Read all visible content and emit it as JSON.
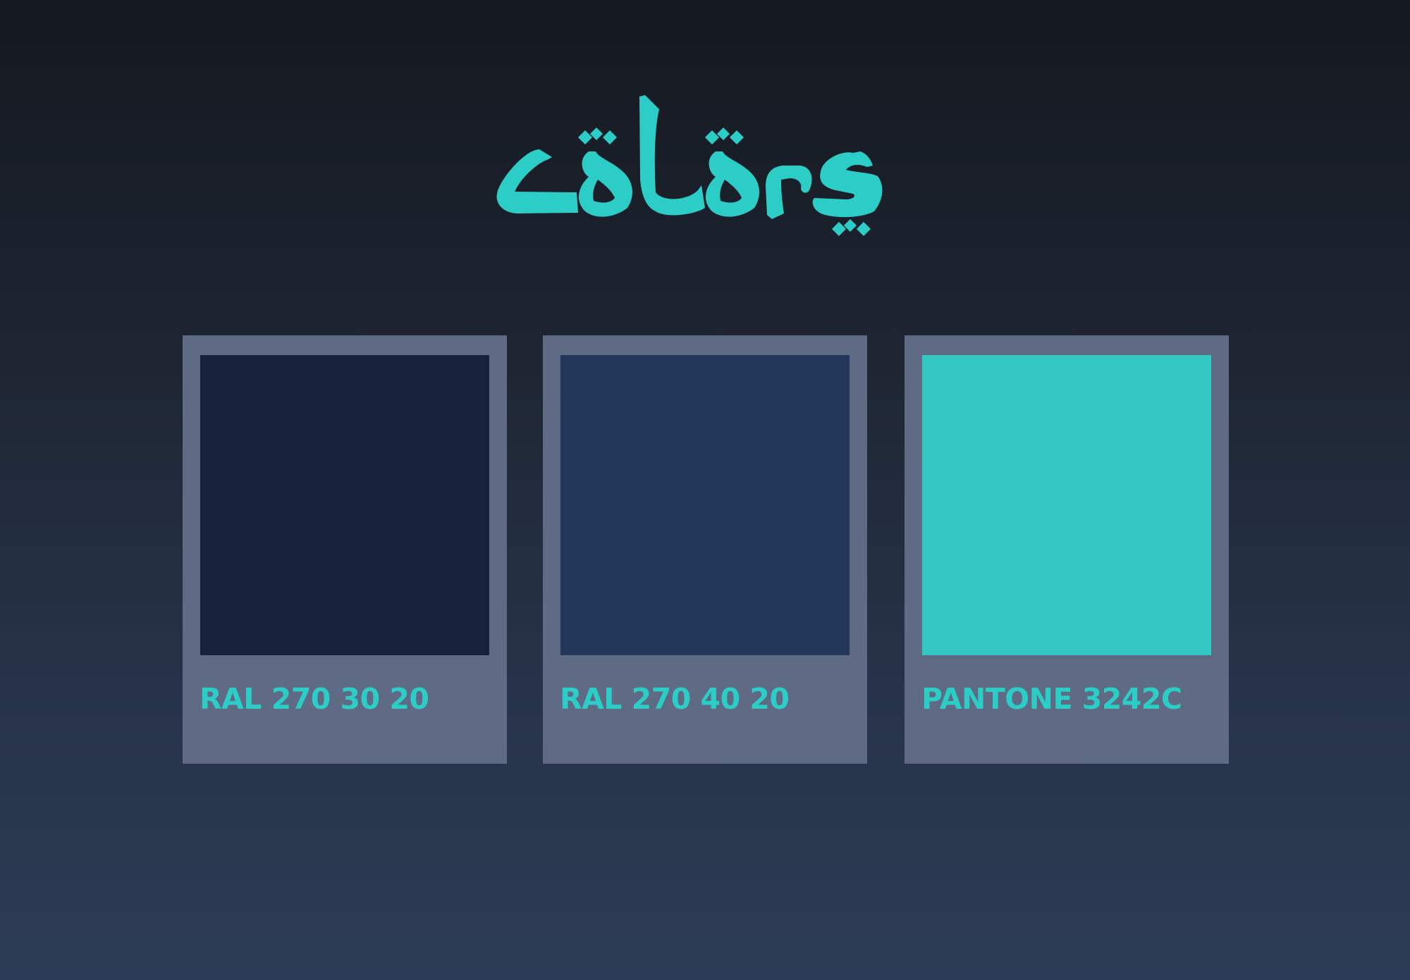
{
  "title": {
    "text": "colors",
    "color": "#2ccdc6"
  },
  "label_color": "#2ccdc6",
  "card_color": "#5f6a84",
  "swatches": [
    {
      "label": "RAL 270 30 20",
      "color": "#18223c"
    },
    {
      "label": "RAL 270 40 20",
      "color": "#23375a"
    },
    {
      "label": "PANTONE 3242C",
      "color": "#33c8c2"
    }
  ]
}
